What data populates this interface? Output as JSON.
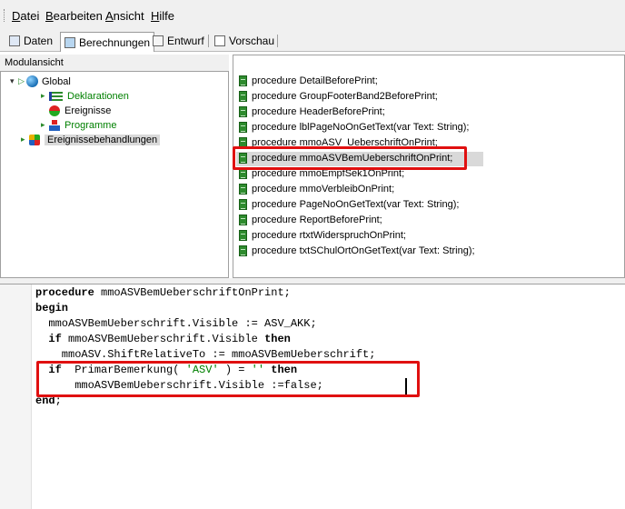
{
  "menu": {
    "items": [
      {
        "accel": "D",
        "rest": "atei"
      },
      {
        "accel": "B",
        "rest": "earbeiten"
      },
      {
        "accel": "A",
        "rest": "nsicht"
      },
      {
        "accel": "H",
        "rest": "ilfe"
      }
    ]
  },
  "tabs": [
    {
      "label": "Daten",
      "icon": "database-icon",
      "active": false
    },
    {
      "label": "Berechnungen",
      "icon": "calculator-icon",
      "active": true
    },
    {
      "label": "Entwurf",
      "icon": "design-icon",
      "active": false
    },
    {
      "label": "Vorschau",
      "icon": "preview-icon",
      "active": false
    }
  ],
  "module_panel": {
    "title": "Modulansicht",
    "tree": {
      "global": "Global",
      "deklarationen": "Deklarationen",
      "ereignisse": "Ereignisse",
      "programme": "Programme",
      "ereignisbehandlungen": "Ereignissebehandlungen"
    }
  },
  "procedures": [
    "procedure DetailBeforePrint;",
    "procedure GroupFooterBand2BeforePrint;",
    "procedure HeaderBeforePrint;",
    "procedure lblPageNoOnGetText(var Text: String);",
    "procedure mmoASV_UeberschriftOnPrint;",
    "procedure mmoASVBemUeberschriftOnPrint;",
    "procedure mmoEmpfSek1OnPrint;",
    "procedure mmoVerbleibOnPrint;",
    "procedure PageNoOnGetText(var Text: String);",
    "procedure ReportBeforePrint;",
    "procedure rtxtWiderspruchOnPrint;",
    "procedure txtSChulOrtOnGetText(var Text: String);"
  ],
  "selected_procedure_index": 5,
  "code": {
    "l1_kw": "procedure",
    "l1_rest": " mmoASVBemUeberschriftOnPrint;",
    "l2_kw": "begin",
    "l3": "  mmoASVBemUeberschrift.Visible := ASV_AKK;",
    "l4_kw1": "  if",
    "l4_mid": " mmoASVBemUeberschrift.Visible ",
    "l4_kw2": "then",
    "l5": "    mmoASV.ShiftRelativeTo := mmoASVBemUeberschrift;",
    "l6_kw1": "  if",
    "l6_a": "  PrimarBemerkung( ",
    "l6_str1": "'ASV'",
    "l6_b": " ) = ",
    "l6_str2": "''",
    "l6_c": " ",
    "l6_kw2": "then",
    "l7": "      mmoASVBemUeberschrift.Visible :=false;",
    "l8_kw": "end",
    "l8_rest": ";"
  },
  "colors": {
    "highlight": "#e01010",
    "keyword_green": "#008000"
  }
}
